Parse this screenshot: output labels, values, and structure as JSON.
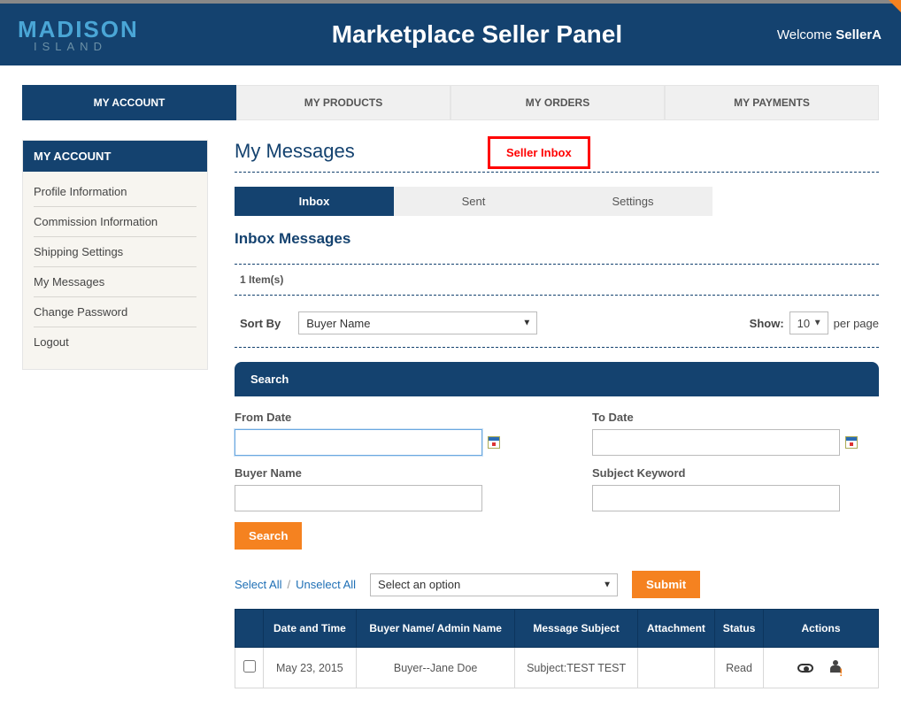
{
  "header": {
    "logo_top": "MADISON",
    "logo_bottom": "ISLAND",
    "title": "Marketplace Seller Panel",
    "welcome_prefix": "Welcome ",
    "welcome_user": "SellerA"
  },
  "tabs": [
    "MY ACCOUNT",
    "MY PRODUCTS",
    "MY ORDERS",
    "MY PAYMENTS"
  ],
  "sidebar": {
    "title": "MY ACCOUNT",
    "items": [
      "Profile Information",
      "Commission Information",
      "Shipping Settings",
      "My Messages",
      "Change Password",
      "Logout"
    ]
  },
  "page": {
    "title": "My Messages",
    "callout": "Seller Inbox",
    "subtabs": [
      "Inbox",
      "Sent",
      "Settings"
    ],
    "section_title": "Inbox Messages",
    "item_count": "1 Item(s)",
    "sort_label": "Sort By",
    "sort_value": "Buyer Name",
    "show_label": "Show:",
    "show_value": "10",
    "show_suffix": "per page"
  },
  "search": {
    "panel_title": "Search",
    "from_date_label": "From Date",
    "to_date_label": "To Date",
    "buyer_label": "Buyer Name",
    "subject_label": "Subject Keyword",
    "button": "Search",
    "from_date_value": "",
    "to_date_value": "",
    "buyer_value": "",
    "subject_value": ""
  },
  "bulk": {
    "select_all": "Select All",
    "unselect_all": "Unselect All",
    "option_placeholder": "Select an option",
    "submit": "Submit"
  },
  "table": {
    "headers": [
      "",
      "Date and Time",
      "Buyer Name/ Admin Name",
      "Message Subject",
      "Attachment",
      "Status",
      "Actions"
    ],
    "rows": [
      {
        "datetime": "May 23, 2015",
        "buyer": "Buyer--Jane Doe",
        "subject": "Subject:TEST TEST",
        "attachment": "",
        "status": "Read"
      }
    ]
  }
}
